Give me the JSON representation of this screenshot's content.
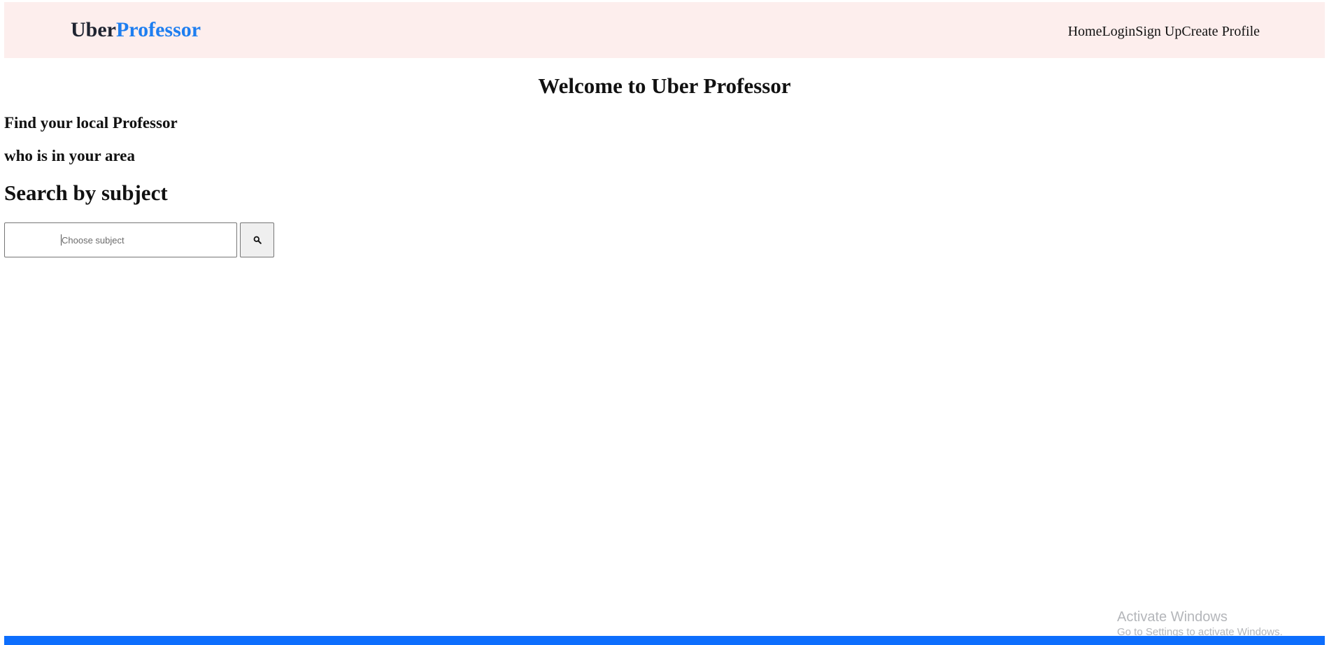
{
  "brand": {
    "part1": "Uber",
    "part2": "Professor",
    "color_part2": "#1e7ef0"
  },
  "nav": {
    "links": [
      "Home",
      "Login",
      "Sign Up",
      "Create Profile"
    ]
  },
  "welcome": {
    "title": "Welcome to Uber Professor"
  },
  "hero": {
    "line1": "Find your local Professor",
    "line2": "who is in your area"
  },
  "search": {
    "heading": "Search by subject",
    "placeholder": "Choose subject",
    "value": "",
    "button_icon": "search-icon"
  },
  "watermark": {
    "title": "Activate Windows",
    "subtitle": "Go to Settings to activate Windows."
  },
  "colors": {
    "navbar_bg": "#fdeeed",
    "accent": "#0d6efd"
  }
}
